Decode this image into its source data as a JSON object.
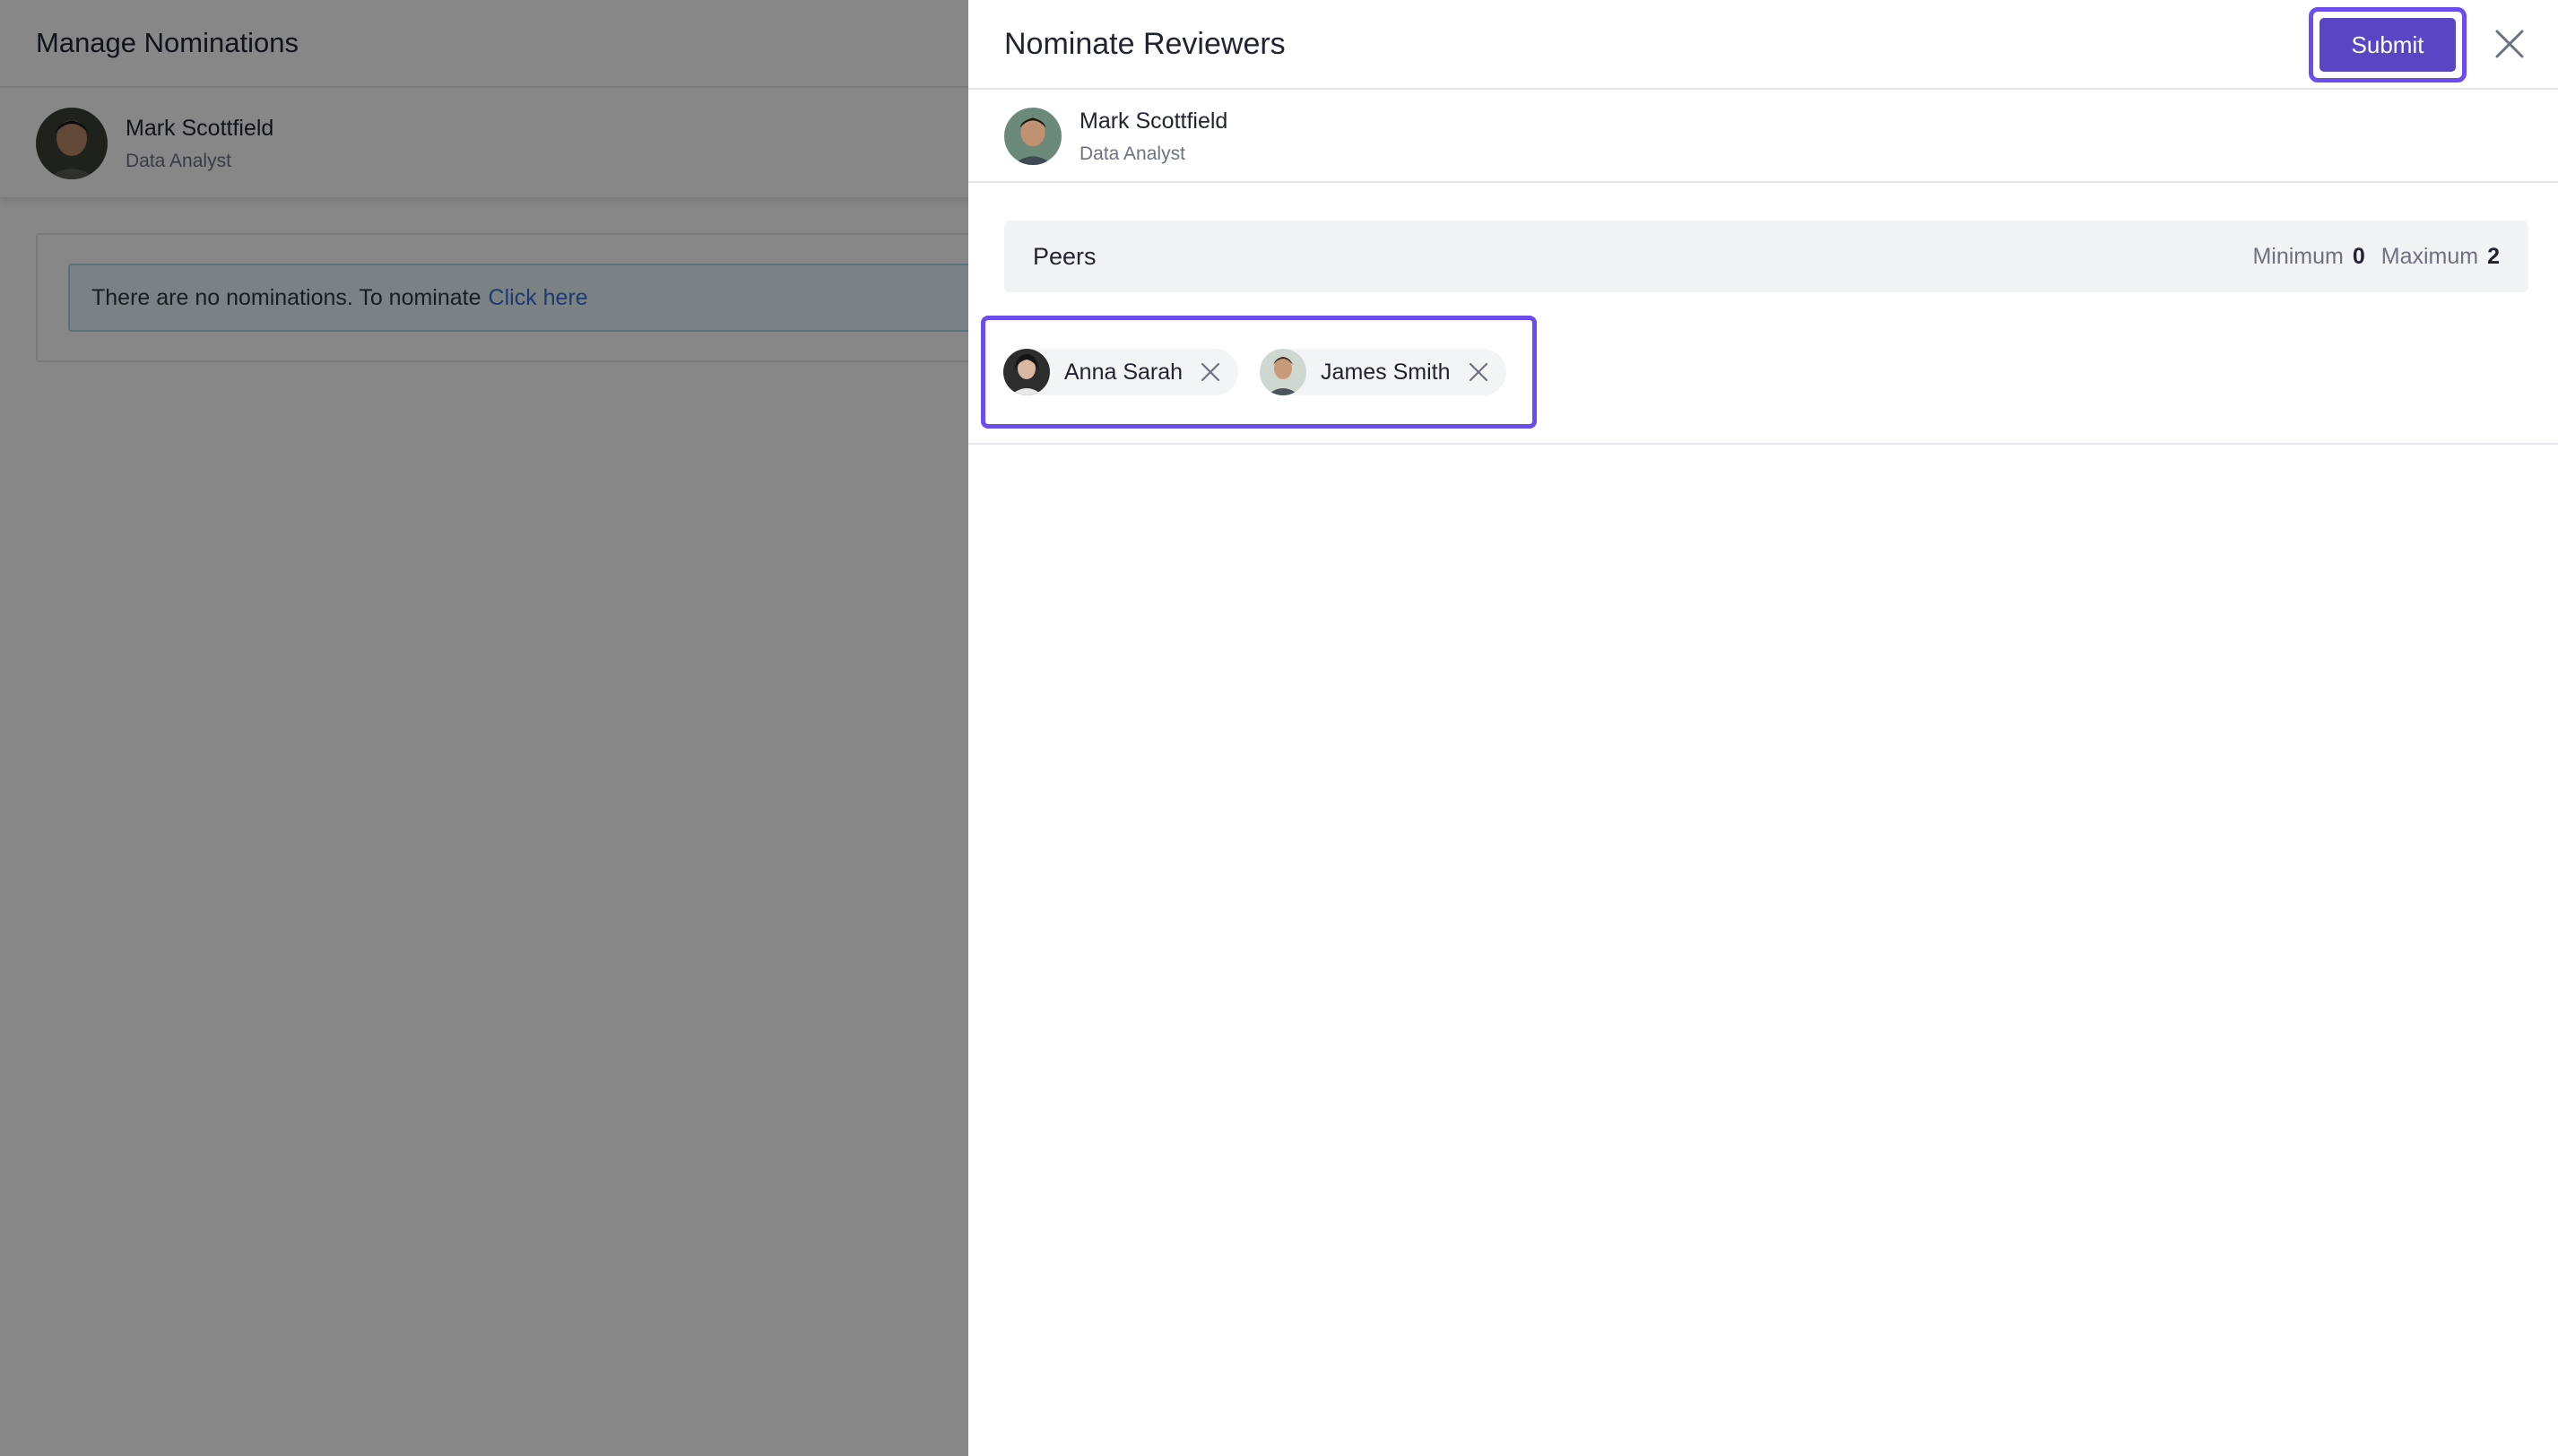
{
  "background": {
    "page_title": "Manage Nominations",
    "user": {
      "name": "Mark Scottfield",
      "role": "Data Analyst"
    },
    "alert": {
      "text": "There are no nominations. To nominate",
      "link": "Click here"
    }
  },
  "drawer": {
    "title": "Nominate Reviewers",
    "submit_label": "Submit",
    "user": {
      "name": "Mark Scottfield",
      "role": "Data Analyst"
    },
    "peers": {
      "label": "Peers",
      "minimum_label": "Minimum",
      "minimum_value": "0",
      "maximum_label": "Maximum",
      "maximum_value": "2"
    },
    "nominees": [
      {
        "name": "Anna Sarah"
      },
      {
        "name": "James Smith"
      }
    ]
  },
  "colors": {
    "accent": "#5a45c4",
    "highlight": "#6a4cf0",
    "link": "#3b6fd6",
    "alert_bg": "#e6f5fa"
  },
  "icons": [
    "close-icon",
    "chip-remove-icon",
    "avatar"
  ]
}
